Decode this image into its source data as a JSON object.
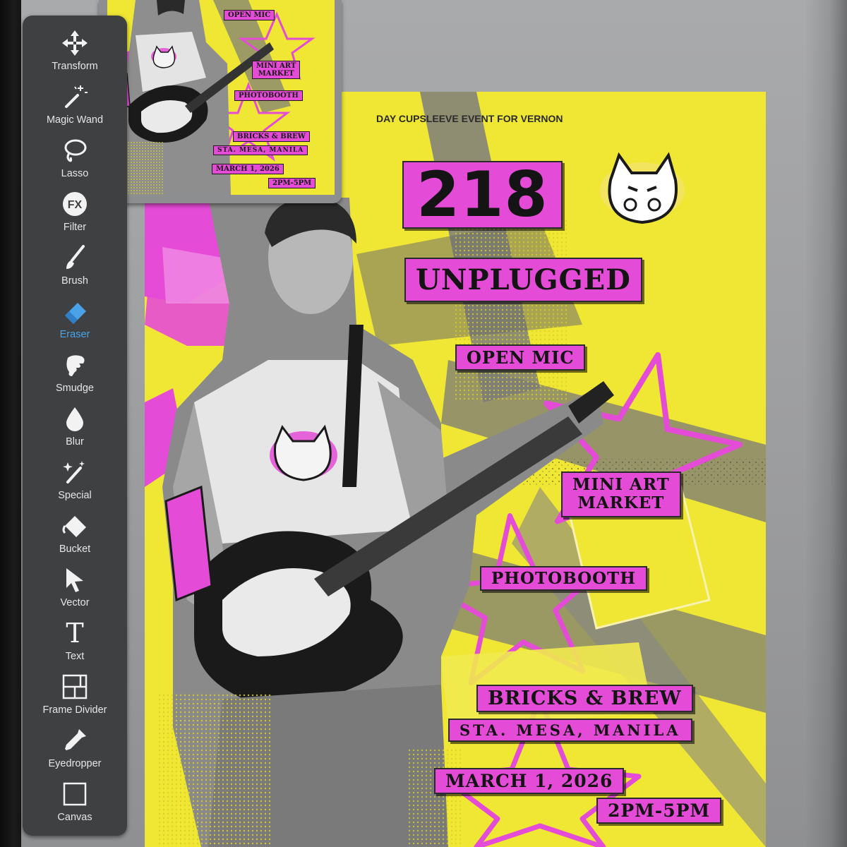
{
  "toolbar": {
    "tools": [
      {
        "label": "Transform",
        "icon": "move-arrows-icon",
        "active": false
      },
      {
        "label": "Magic Wand",
        "icon": "magic-wand-icon",
        "active": false
      },
      {
        "label": "Lasso",
        "icon": "lasso-icon",
        "active": false
      },
      {
        "label": "Filter",
        "icon": "fx-icon",
        "icon_text": "FX",
        "active": false
      },
      {
        "label": "Brush",
        "icon": "brush-icon",
        "active": false
      },
      {
        "label": "Eraser",
        "icon": "eraser-icon",
        "active": true
      },
      {
        "label": "Smudge",
        "icon": "smudge-finger-icon",
        "active": false
      },
      {
        "label": "Blur",
        "icon": "droplet-icon",
        "active": false
      },
      {
        "label": "Special",
        "icon": "special-wand-icon",
        "active": false
      },
      {
        "label": "Bucket",
        "icon": "bucket-icon",
        "active": false
      },
      {
        "label": "Vector",
        "icon": "pointer-arrow-icon",
        "active": false
      },
      {
        "label": "Text",
        "icon": "text-T-icon",
        "icon_text": "T",
        "active": false
      },
      {
        "label": "Frame Divider",
        "icon": "frame-divider-icon",
        "active": false
      },
      {
        "label": "Eyedropper",
        "icon": "eyedropper-icon",
        "active": false
      },
      {
        "label": "Canvas",
        "icon": "canvas-square-icon",
        "active": false
      }
    ],
    "active_color": "#4aa3e8"
  },
  "poster": {
    "header": "DAY CUPSLEEVE EVENT FOR VERNON",
    "title_number": "218",
    "title_word": "UNPLUGGED",
    "open_mic": "OPEN MIC",
    "mini_art_line1": "MINI ART",
    "mini_art_line2": "MARKET",
    "photobooth": "PHOTOBOOTH",
    "venue": "BRICKS & BREW",
    "location": "STA. MESA, MANILA",
    "date": "MARCH 1, 2026",
    "time": "2PM-5PM",
    "colors": {
      "yellow": "#efe733",
      "magenta": "#e44bd6",
      "ink": "#141414"
    }
  },
  "thumbnail": {
    "open_mic": "OPEN MIC",
    "mini_art_line1": "MINI ART",
    "mini_art_line2": "MARKET",
    "photobooth": "PHOTOBOOTH",
    "venue": "BRICKS & BREW",
    "location": "STA. MESA, MANILA",
    "date": "MARCH 1, 2026",
    "time": "2PM-5PM"
  }
}
